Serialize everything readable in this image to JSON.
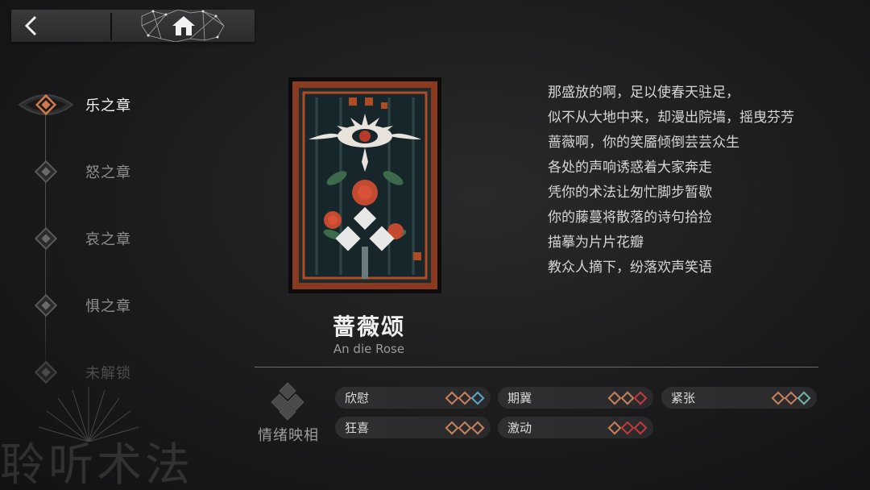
{
  "nav": {
    "back_icon": "chevron-left-icon",
    "home_icon": "home-icon"
  },
  "chapters": [
    {
      "label": "乐之章",
      "state": "active"
    },
    {
      "label": "怒之章",
      "state": "normal"
    },
    {
      "label": "哀之章",
      "state": "normal"
    },
    {
      "label": "惧之章",
      "state": "normal"
    },
    {
      "label": "未解锁",
      "state": "locked"
    }
  ],
  "watermark": "聆听术法",
  "card": {
    "title": "蔷薇颂",
    "subtitle": "An die Rose"
  },
  "poem": [
    "那盛放的啊，足以使春天驻足，",
    "似不从大地中来，却漫出院墙，摇曳芬芳",
    "蔷薇啊，你的笑靥倾倒芸芸众生",
    "各处的声响诱惑着大家奔走",
    "凭你的术法让匆忙脚步暂歇",
    "你的藤蔓将散落的诗句拾捡",
    "描摹为片片花瓣",
    "教众人摘下，纷落欢声笑语"
  ],
  "emotion": {
    "title": "情绪映相",
    "tags": [
      {
        "name": "欣慰",
        "gems": [
          "orange",
          "orange",
          "blue"
        ]
      },
      {
        "name": "期冀",
        "gems": [
          "orange",
          "orange",
          "red"
        ]
      },
      {
        "name": "紧张",
        "gems": [
          "orange",
          "orange",
          "teal"
        ]
      },
      {
        "name": "狂喜",
        "gems": [
          "orange",
          "orange",
          "orange"
        ]
      },
      {
        "name": "激动",
        "gems": [
          "orange",
          "red",
          "red"
        ]
      }
    ]
  },
  "colors": {
    "accent_orange": "#c8825a",
    "accent_blue": "#5aa7c8",
    "accent_red": "#c23a3a",
    "accent_teal": "#6fb7a8"
  }
}
